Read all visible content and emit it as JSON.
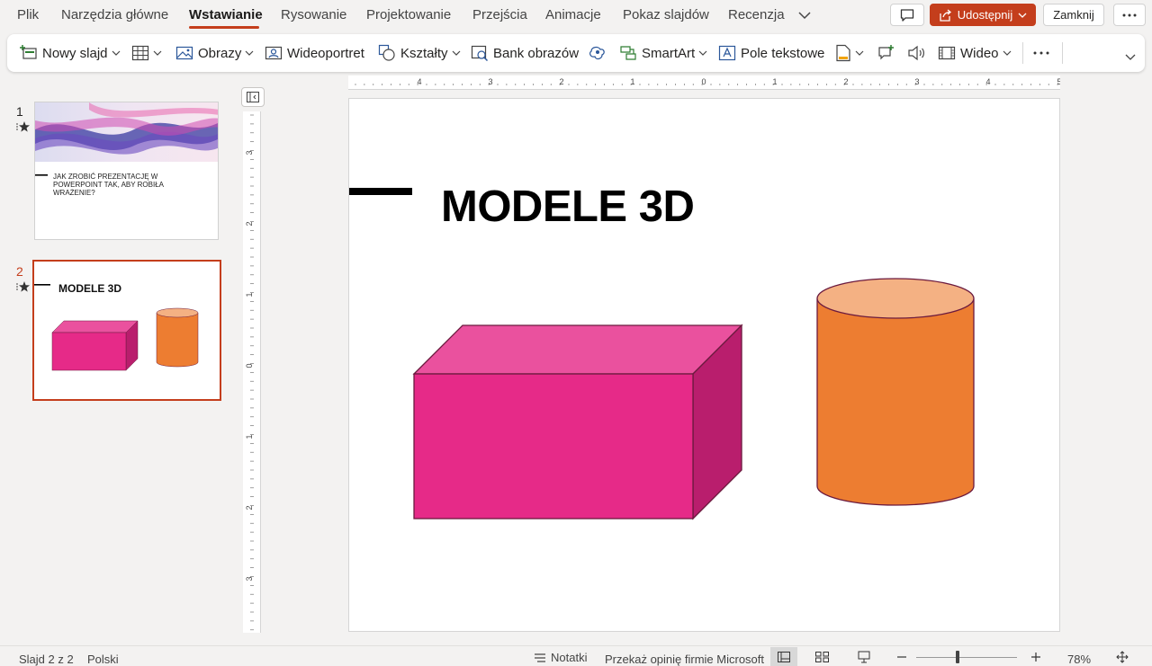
{
  "tabs": [
    {
      "label": "Plik"
    },
    {
      "label": "Narzędzia główne"
    },
    {
      "label": "Wstawianie"
    },
    {
      "label": "Rysowanie"
    },
    {
      "label": "Projektowanie"
    },
    {
      "label": "Przejścia"
    },
    {
      "label": "Animacje"
    },
    {
      "label": "Pokaz slajdów"
    },
    {
      "label": "Recenzja"
    }
  ],
  "header": {
    "share_label": "Udostępnij",
    "close_label": "Zamknij"
  },
  "ribbon": {
    "new_slide": "Nowy slajd",
    "images": "Obrazy",
    "video_portrait": "Wideoportret",
    "shapes": "Kształty",
    "stock_images": "Bank obrazów",
    "smartart": "SmartArt",
    "text_box": "Pole tekstowe",
    "video": "Wideo"
  },
  "ruler": {
    "horizontal_labels": [
      "4",
      "3",
      "2",
      "1",
      "0",
      "1",
      "2",
      "3",
      "4",
      "5"
    ],
    "vertical_labels": [
      "3",
      "2",
      "1",
      "0",
      "1",
      "2",
      "3"
    ]
  },
  "thumbnails": [
    {
      "number": "1",
      "text": "JAK ZROBIĆ PREZENTACJĘ W POWERPOINT TAK, ABY ROBIŁA WRAŻENIE?"
    },
    {
      "number": "2",
      "title": "MODELE 3D"
    }
  ],
  "slide": {
    "title": "MODELE 3D",
    "colors": {
      "box_front": "#e62a88",
      "box_top": "#ea519e",
      "box_side": "#b91e6d",
      "cylinder_body": "#ed7d31",
      "cylinder_top": "#f4b183",
      "outline": "#6b1a3e"
    }
  },
  "status": {
    "slide_info": "Slajd 2 z 2",
    "language": "Polski",
    "notes": "Notatki",
    "feedback": "Przekaż opinię firmie Microsoft",
    "zoom": "78%",
    "zoom_fraction": 0.41
  }
}
